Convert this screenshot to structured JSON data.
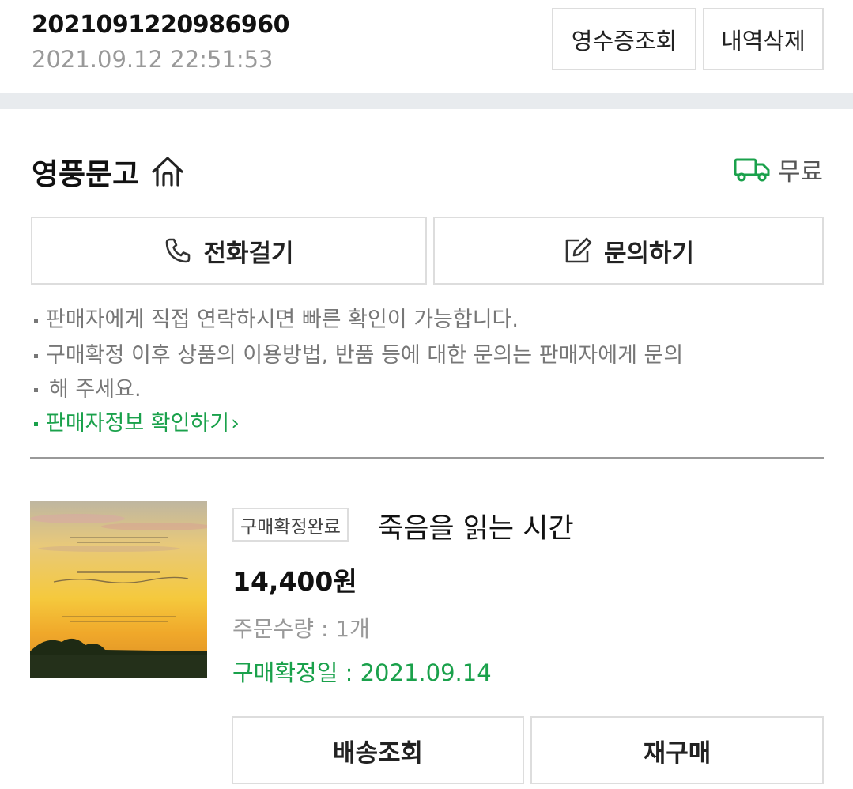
{
  "order": {
    "number": "2021091220986960",
    "datetime": "2021.09.12 22:51:53",
    "receipt_label": "영수증조회",
    "delete_label": "내역삭제"
  },
  "seller": {
    "name": "영풍문고",
    "home_icon": "home-icon",
    "shipping_icon": "truck-icon",
    "shipping_fee": "무료",
    "call_label": "전화걸기",
    "inquiry_label": "문의하기"
  },
  "notes": [
    "판매자에게 직접 연락하시면 빠른 확인이 가능합니다.",
    "구매확정 이후 상품의 이용방법, 반품 등에 대한 문의는 판매자에게 문의",
    "해 주세요."
  ],
  "seller_info_link": "판매자정보 확인하기",
  "seller_info_chevron": "›",
  "product": {
    "status": "구매확정완료",
    "title": "죽음을 읽는 시간",
    "price": "14,400원",
    "quantity": "주문수량 : 1개",
    "confirm_date": "구매확정일 : 2021.09.14"
  },
  "actions": {
    "track_label": "배송조회",
    "rebuy_label": "재구매"
  },
  "colors": {
    "accent_green": "#1aa14b",
    "divider": "#e8ebee"
  }
}
